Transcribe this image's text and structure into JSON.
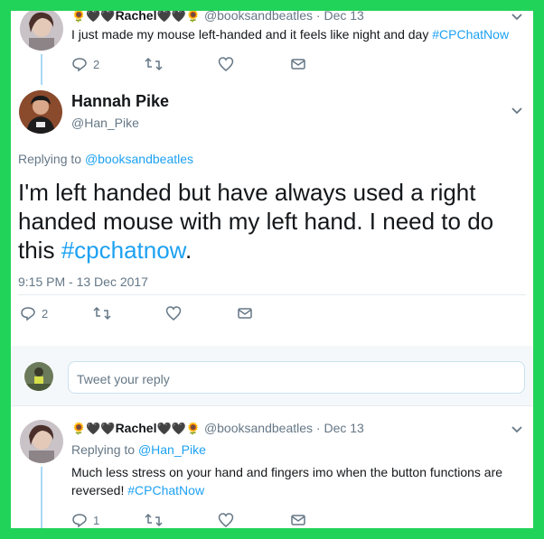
{
  "first_tweet": {
    "display_name_prefix": "🌻🖤🖤",
    "display_name": "Rachel",
    "display_name_suffix": "🖤🖤🌻",
    "handle": "@booksandbeatles",
    "date": "· Dec 13",
    "text": "I just made my mouse left-handed and it feels like night and day ",
    "hashtag": "#CPChatNow",
    "reply_count": "2"
  },
  "main_tweet": {
    "display_name": "Hannah Pike",
    "handle": "@Han_Pike",
    "replying_to_label": "Replying to ",
    "replying_to_handle": "@booksandbeatles",
    "text": "I'm left handed but have always used a right handed mouse with my left hand.  I need to do this ",
    "hashtag": "#cpchatnow",
    "text_end": ".",
    "timestamp": "9:15 PM - 13 Dec 2017",
    "reply_count": "2"
  },
  "reply_box": {
    "placeholder": "Tweet your reply"
  },
  "second_tweet": {
    "display_name_prefix": "🌻🖤🖤",
    "display_name": "Rachel",
    "display_name_suffix": "🖤🖤🌻",
    "handle": "@booksandbeatles",
    "date": "· Dec 13",
    "replying_to_label": "Replying to ",
    "replying_to_handle": "@Han_Pike",
    "text": "Much less stress on your hand and fingers imo when the button functions are reversed! ",
    "hashtag": "#CPChatNow",
    "reply_count": "1"
  },
  "colors": {
    "frame": "#22d35a",
    "link": "#1da1f2",
    "muted": "#657786",
    "thread_line": "#a8d9f5"
  }
}
